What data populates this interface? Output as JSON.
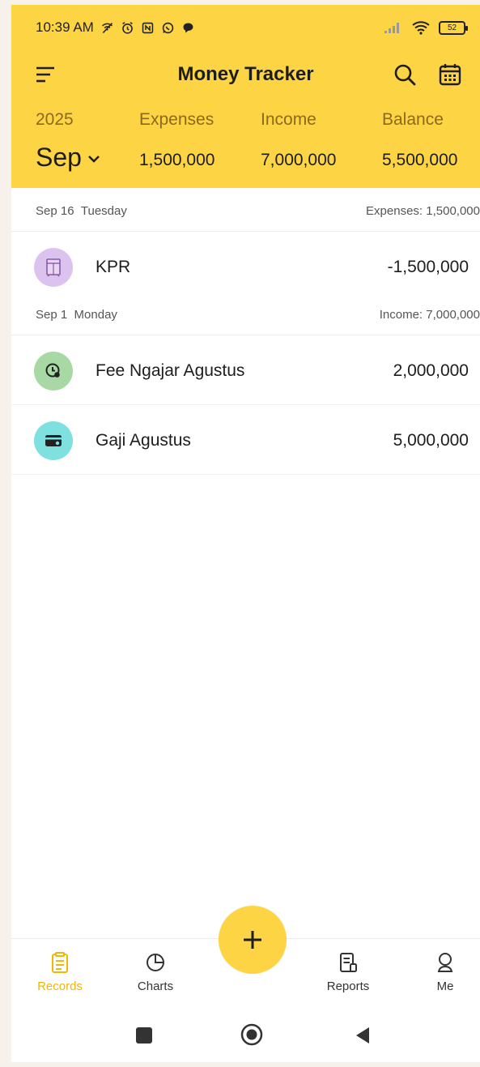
{
  "status_bar": {
    "time": "10:39 AM",
    "battery": "52",
    "icons": [
      "wifi-off-icon",
      "alarm-icon",
      "nfc-icon",
      "whatsapp-icon",
      "chat-bubble-icon",
      "signal-icon",
      "wifi-icon",
      "battery-icon"
    ]
  },
  "header": {
    "title": "Money Tracker",
    "year": "2025",
    "month": "Sep",
    "labels": {
      "expenses": "Expenses",
      "income": "Income",
      "balance": "Balance"
    },
    "values": {
      "expenses": "1,500,000",
      "income": "7,000,000",
      "balance": "5,500,000"
    },
    "background": "#fdd443"
  },
  "days": [
    {
      "date": "Sep 16",
      "weekday": "Tuesday",
      "summary": "Expenses: 1,500,000",
      "records": [
        {
          "name": "KPR",
          "amount": "-1,500,000",
          "icon": "cabinet-icon",
          "icon_bg": "#dcc2ef"
        }
      ]
    },
    {
      "date": "Sep 1",
      "weekday": "Monday",
      "summary": "Income: 7,000,000",
      "records": [
        {
          "name": "Fee Ngajar Agustus",
          "amount": "2,000,000",
          "icon": "clock-coin-icon",
          "icon_bg": "#a8d9a4"
        },
        {
          "name": "Gaji Agustus",
          "amount": "5,000,000",
          "icon": "wallet-icon",
          "icon_bg": "#7fe0e0"
        }
      ]
    }
  ],
  "bottom_nav": {
    "items": [
      {
        "label": "Records",
        "icon": "records-icon",
        "active": true
      },
      {
        "label": "Charts",
        "icon": "charts-icon",
        "active": false
      },
      {
        "label": "Reports",
        "icon": "reports-icon",
        "active": false
      },
      {
        "label": "Me",
        "icon": "profile-icon",
        "active": false
      }
    ],
    "add_icon": "plus-icon",
    "active_color": "#f2b705"
  },
  "system_nav": [
    "recents-icon",
    "home-icon",
    "back-icon"
  ]
}
